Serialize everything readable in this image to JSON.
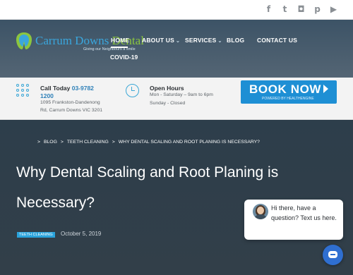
{
  "social": {
    "icons": [
      "facebook-icon",
      "twitter-icon",
      "instagram-icon",
      "pinterest-icon",
      "youtube-icon"
    ],
    "glyphs": [
      "f",
      "t",
      "◘",
      "p",
      "▶"
    ]
  },
  "header": {
    "brand_main": "Carrum Downs ",
    "brand_accent": "Dental",
    "tagline": "Giving our Neighbours a smile",
    "nav": {
      "home": "HOME",
      "about": "ABOUT US",
      "services": "SERVICES",
      "blog": "BLOG",
      "contact": "CONTACT US",
      "covid": "COVID-19"
    },
    "colors": {
      "brand": "#3aa6dd",
      "accent": "#8cc63f"
    }
  },
  "infobar": {
    "call_label": "Call Today ",
    "phone_part1": "03-9782",
    "phone_part2": "1200",
    "address_line1": "1095 Frankston-Dandenong",
    "address_line2": "Rd, Carrum Downs VIC 3201",
    "hours_title": "Open Hours",
    "hours_line1": "Mon - Saturday – 9am to 6pm",
    "hours_line2": "Sunday - Closed",
    "book_label": "BOOK NOW",
    "book_sub": "POWERED BY HEALTHENGINE",
    "book_color": "#1e8fd4"
  },
  "hero": {
    "breadcrumb": [
      "BLOG",
      "TEETH CLEANING",
      "WHY DENTAL SCALING AND ROOT PLANING IS NECESSARY?"
    ],
    "title_line1": "Why Dental Scaling and Root Planing is",
    "title_line2": "Necessary?",
    "category": "TEETH CLEANING",
    "date": "October 5, 2019"
  },
  "chat": {
    "message": "Hi there, have a question? Text us here.",
    "fab_color": "#2f6fd1"
  }
}
